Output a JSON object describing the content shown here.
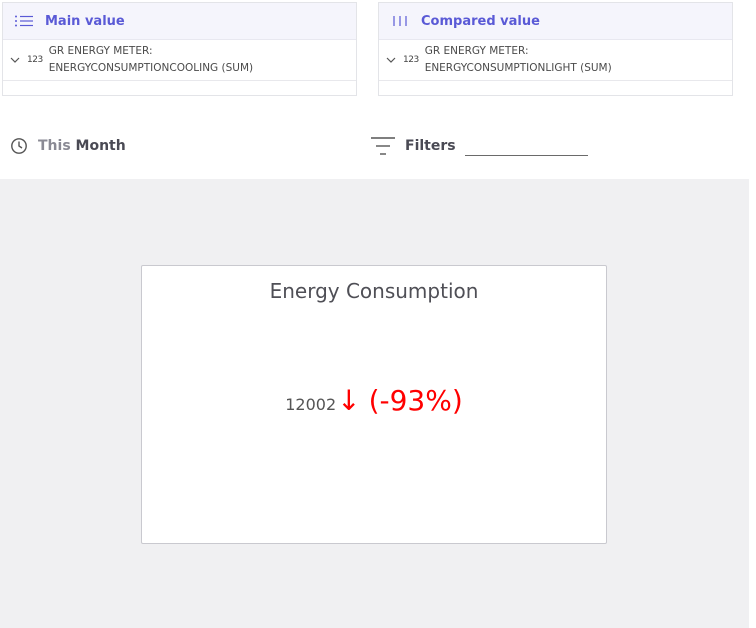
{
  "main_value": {
    "title": "Main value",
    "icon": "list-icon",
    "field": {
      "type_badge": "123",
      "line1": "GR ENERGY METER:",
      "line2": "ENERGYCONSUMPTIONCOOLING (SUM)"
    }
  },
  "compared_value": {
    "title": "Compared value",
    "icon": "columns-icon",
    "field": {
      "type_badge": "123",
      "line1": "GR ENERGY METER:",
      "line2": "ENERGYCONSUMPTIONLIGHT (SUM)"
    }
  },
  "toolbar": {
    "time_prefix": "This",
    "time_period": "Month",
    "time_icon": "clock-icon",
    "filters_label": "Filters",
    "filters_icon": "filter-icon",
    "filters_value": ""
  },
  "kpi": {
    "title": "Energy Consumption",
    "value": "12002",
    "arrow": "↓",
    "change": "(-93%)",
    "change_color": "#ff0000"
  },
  "colors": {
    "accent": "#5a5ad6",
    "negative": "#ff0000",
    "canvas_bg": "#f0f0f2"
  }
}
